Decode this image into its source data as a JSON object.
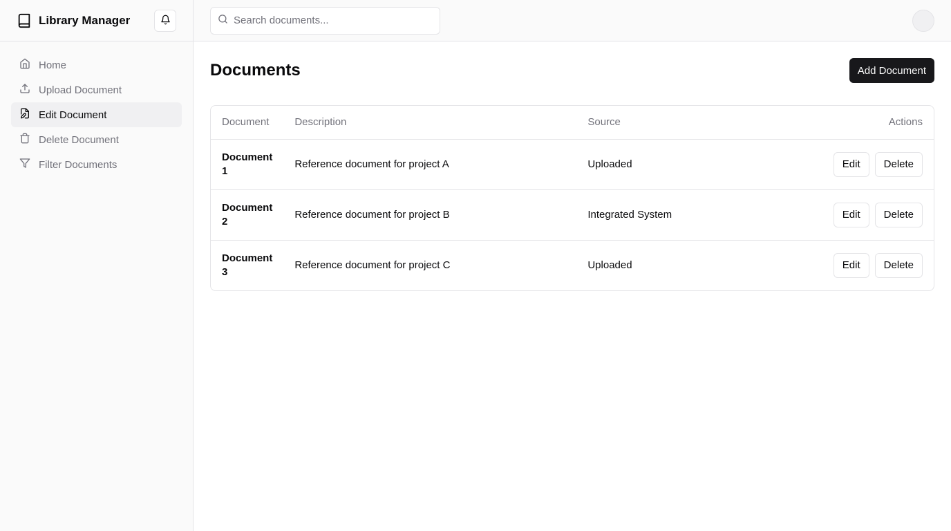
{
  "app": {
    "title": "Library Manager"
  },
  "sidebar": {
    "items": [
      {
        "label": "Home",
        "icon": "home-icon",
        "active": false
      },
      {
        "label": "Upload Document",
        "icon": "upload-icon",
        "active": false
      },
      {
        "label": "Edit Document",
        "icon": "edit-document-icon",
        "active": true
      },
      {
        "label": "Delete Document",
        "icon": "trash-icon",
        "active": false
      },
      {
        "label": "Filter Documents",
        "icon": "filter-icon",
        "active": false
      }
    ]
  },
  "topbar": {
    "search_placeholder": "Search documents..."
  },
  "main": {
    "title": "Documents",
    "add_button": "Add Document"
  },
  "table": {
    "headers": {
      "document": "Document",
      "description": "Description",
      "source": "Source",
      "actions": "Actions"
    },
    "rows": [
      {
        "document": "Document 1",
        "description": "Reference document for project A",
        "source": "Uploaded",
        "edit": "Edit",
        "delete": "Delete"
      },
      {
        "document": "Document 2",
        "description": "Reference document for project B",
        "source": "Integrated System",
        "edit": "Edit",
        "delete": "Delete"
      },
      {
        "document": "Document 3",
        "description": "Reference document for project C",
        "source": "Uploaded",
        "edit": "Edit",
        "delete": "Delete"
      }
    ]
  },
  "colors": {
    "primary": "#18181b",
    "muted_text": "#71717a",
    "border": "#e4e4e7",
    "sidebar_bg": "#fafafa",
    "active_bg": "#f0f0f2"
  }
}
